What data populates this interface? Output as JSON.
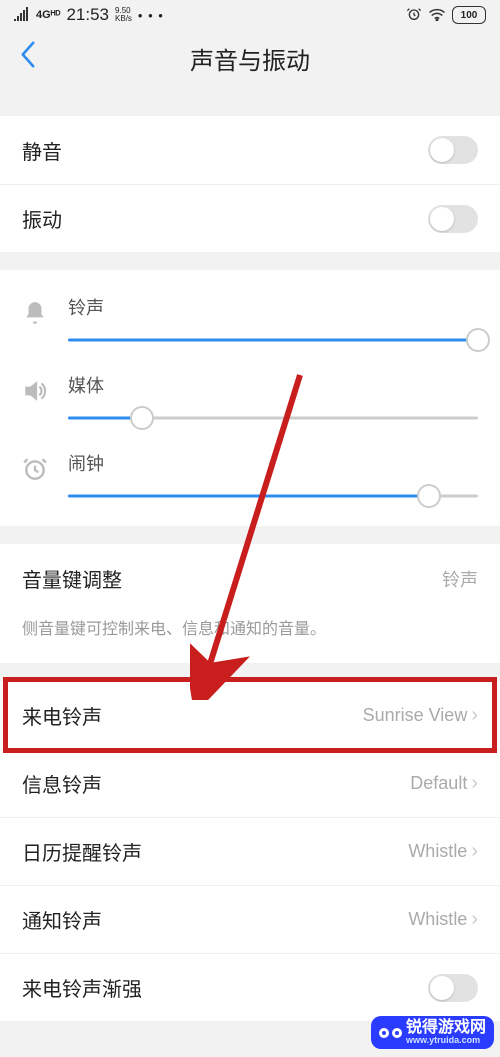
{
  "status": {
    "signal_label": "4Gᴴᴰ",
    "clock": "21:53",
    "net_speed_top": "9.50",
    "net_speed_bottom": "KB/s",
    "dots": "• • •",
    "alarm_icon": "alarm",
    "wifi_icon": "wifi",
    "battery": "100"
  },
  "header": {
    "title": "声音与振动"
  },
  "toggles": {
    "mute": {
      "label": "静音",
      "on": false
    },
    "vibrate": {
      "label": "振动",
      "on": false
    }
  },
  "sliders": {
    "ring": {
      "label": "铃声",
      "value": 100
    },
    "media": {
      "label": "媒体",
      "value": 18
    },
    "alarm": {
      "label": "闹钟",
      "value": 88
    }
  },
  "volume_key": {
    "label": "音量键调整",
    "value": "铃声",
    "desc": "侧音量键可控制来电、信息和通知的音量。"
  },
  "ringtones": {
    "incoming": {
      "label": "来电铃声",
      "value": "Sunrise View"
    },
    "message": {
      "label": "信息铃声",
      "value": "Default"
    },
    "calendar": {
      "label": "日历提醒铃声",
      "value": "Whistle"
    },
    "notify": {
      "label": "通知铃声",
      "value": "Whistle"
    },
    "fadein": {
      "label": "来电铃声渐强",
      "on": false
    }
  },
  "watermark": {
    "cn": "锐得游戏网",
    "url": "www.ytruida.com"
  }
}
